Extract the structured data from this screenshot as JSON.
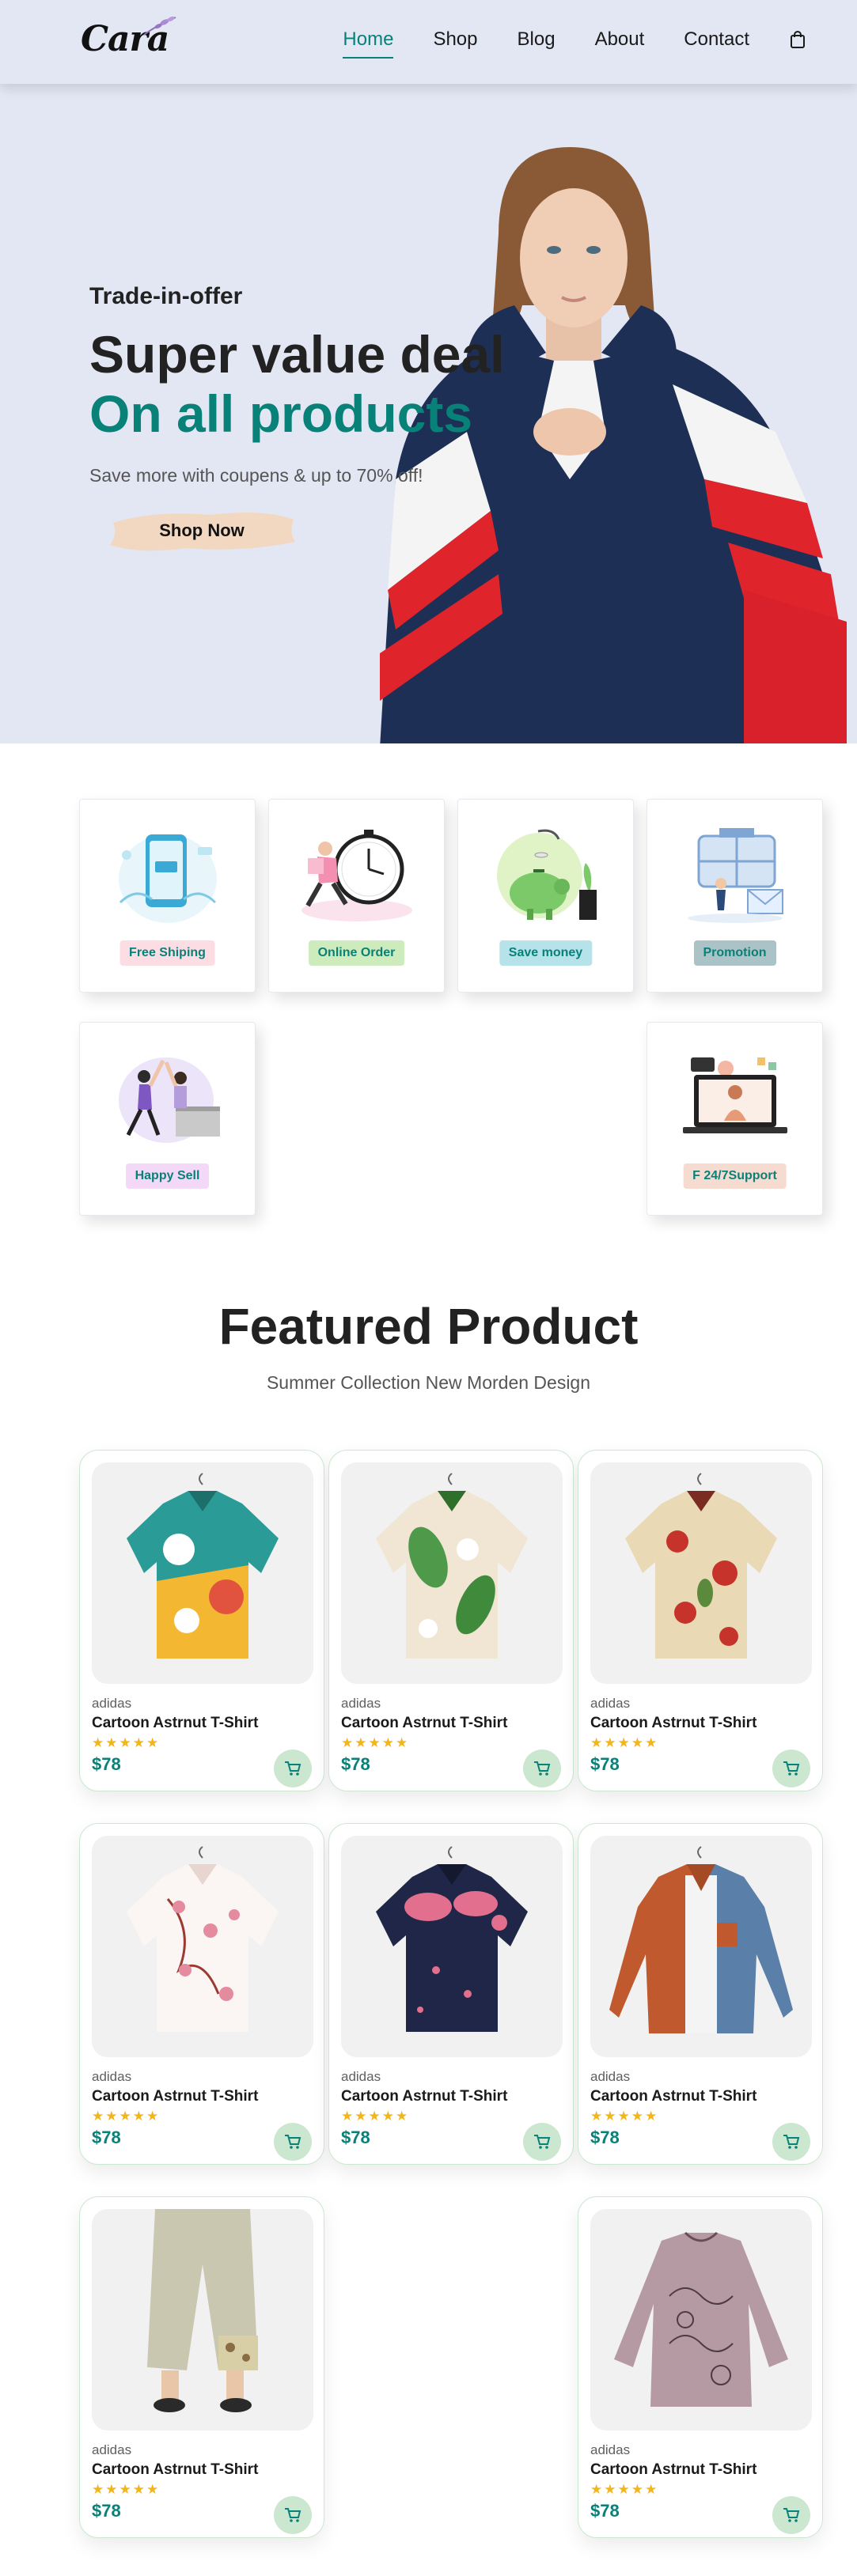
{
  "header": {
    "logo": "Cara",
    "nav": [
      {
        "label": "Home",
        "active": true
      },
      {
        "label": "Shop",
        "active": false
      },
      {
        "label": "Blog",
        "active": false
      },
      {
        "label": "About",
        "active": false
      },
      {
        "label": "Contact",
        "active": false
      }
    ],
    "bag_icon": "shopping-bag-icon"
  },
  "hero": {
    "kicker": "Trade-in-offer",
    "title": "Super value deal",
    "title_accent": "On all products",
    "subtitle": "Save more with coupens & up to 70% off!",
    "cta": "Shop Now"
  },
  "features": [
    {
      "label": "Free Shiping",
      "tag_bg": "#fddde4",
      "icon": "phone-delivery-illustration"
    },
    {
      "label": "Online Order",
      "tag_bg": "#cdebbc",
      "icon": "clock-runner-illustration"
    },
    {
      "label": "Save money",
      "tag_bg": "#b6e2ea",
      "icon": "piggy-bank-illustration"
    },
    {
      "label": "Promotion",
      "tag_bg": "#abc3c6",
      "icon": "mail-promotion-illustration"
    },
    {
      "label": "Happy Sell",
      "tag_bg": "#f3d9f7",
      "icon": "high-five-illustration"
    },
    {
      "label": "F 24/7Support",
      "tag_bg": "#f6dbd1",
      "icon": "laptop-support-illustration"
    }
  ],
  "featured": {
    "title": "Featured Product",
    "subtitle": "Summer Collection New Morden Design",
    "products": [
      {
        "brand": "adidas",
        "name": "Cartoon Astrnut T-Shirt",
        "rating": 5,
        "stars": "★★★★★",
        "price": "$78"
      },
      {
        "brand": "adidas",
        "name": "Cartoon Astrnut T-Shirt",
        "rating": 5,
        "stars": "★★★★★",
        "price": "$78"
      },
      {
        "brand": "adidas",
        "name": "Cartoon Astrnut T-Shirt",
        "rating": 5,
        "stars": "★★★★★",
        "price": "$78"
      },
      {
        "brand": "adidas",
        "name": "Cartoon Astrnut T-Shirt",
        "rating": 5,
        "stars": "★★★★★",
        "price": "$78"
      },
      {
        "brand": "adidas",
        "name": "Cartoon Astrnut T-Shirt",
        "rating": 5,
        "stars": "★★★★★",
        "price": "$78"
      },
      {
        "brand": "adidas",
        "name": "Cartoon Astrnut T-Shirt",
        "rating": 5,
        "stars": "★★★★★",
        "price": "$78"
      },
      {
        "brand": "adidas",
        "name": "Cartoon Astrnut T-Shirt",
        "rating": 5,
        "stars": "★★★★★",
        "price": "$78"
      },
      {
        "brand": "adidas",
        "name": "Cartoon Astrnut T-Shirt",
        "rating": 5,
        "stars": "★★★★★",
        "price": "$78"
      }
    ]
  },
  "colors": {
    "accent": "#088178",
    "header_bg": "#e3e6f3",
    "star": "#f3b519",
    "cart_bg": "#cce7d0"
  }
}
